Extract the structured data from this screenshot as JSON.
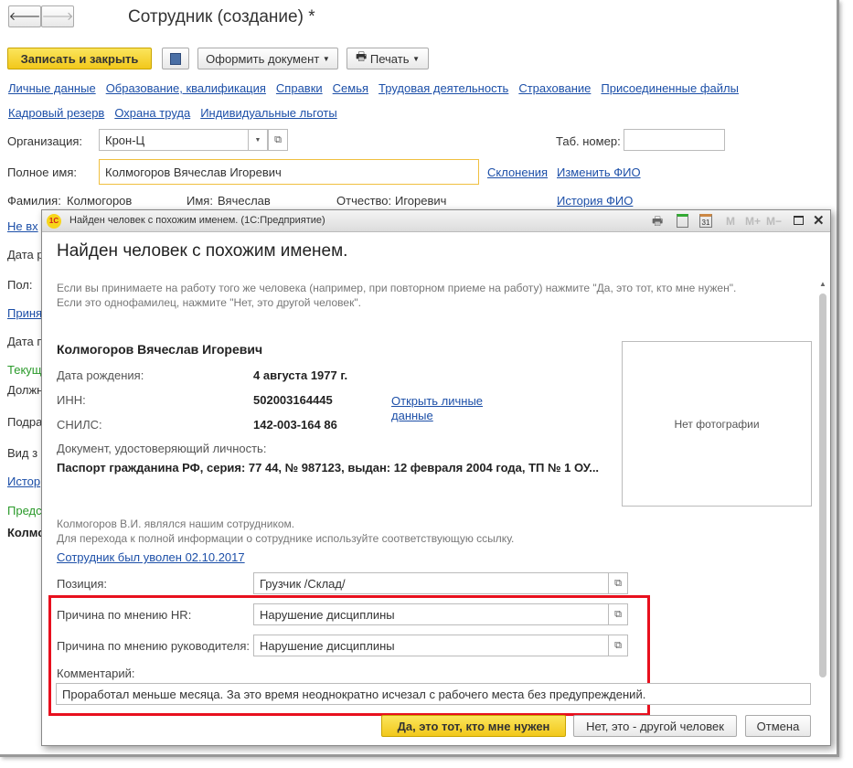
{
  "window": {
    "title": "Сотрудник (создание) *"
  },
  "toolbar": {
    "save_close": "Записать и закрыть",
    "make_doc": "Оформить документ",
    "print": "Печать"
  },
  "tabs_row1": [
    "Личные данные",
    "Образование, квалификация",
    "Справки",
    "Семья",
    "Трудовая деятельность",
    "Страхование",
    "Присоединенные файлы"
  ],
  "tabs_row2": [
    "Кадровый резерв",
    "Охрана труда",
    "Индивидуальные льготы"
  ],
  "form": {
    "org_label": "Организация:",
    "org_value": "Крон-Ц",
    "tab_num_label": "Таб. номер:",
    "fullname_label": "Полное имя:",
    "fullname_value": "Колмогоров Вячеслав Игоревич",
    "declension_link": "Склонения",
    "change_fio_link": "Изменить ФИО",
    "history_fio_link": "История ФИО",
    "surname_label": "Фамилия:",
    "surname_value": "Колмогоров",
    "name_label": "Имя:",
    "name_value": "Вячеслав",
    "patronymic_label": "Отчество:",
    "patronymic_value": "Игоревич",
    "left_fragments": [
      "Не вх",
      "Дата р",
      "Пол:",
      "Приня",
      "Дата п",
      "Текущ",
      "Должн",
      "Подра",
      "Вид з",
      "Истор",
      "Предс",
      "Колмо"
    ]
  },
  "dialog": {
    "title": "Найден человек с похожим именем.  (1С:Предприятие)",
    "title_icons": [
      "M",
      "M+",
      "M−"
    ],
    "heading": "Найден человек с похожим именем.",
    "hint1": "Если вы принимаете на работу того же человека (например, при повторном приеме на работу) нажмите \"Да, это тот, кто мне нужен\".",
    "hint2": "Если это однофамилец, нажмите \"Нет, это другой человек\".",
    "person_name": "Колмогоров Вячеслав Игоревич",
    "birth_label": "Дата рождения:",
    "birth_value": "4 августа 1977 г.",
    "inn_label": "ИНН:",
    "inn_value": "502003164445",
    "snils_label": "СНИЛС:",
    "snils_value": "142-003-164 86",
    "open_personal_link1": "Открыть личные",
    "open_personal_link2": "данные",
    "doc_label": "Документ, удостоверяющий личность:",
    "doc_value": "Паспорт гражданина РФ, серия: 77 44, № 987123, выдан: 12 февраля 2004 года, ТП № 1 ОУ...",
    "no_photo": "Нет фотографии",
    "was_employee": "Колмогоров В.И. являлся нашим сотрудником.",
    "goto_hint": "Для перехода к полной информации о сотруднике используйте соответствующую ссылку.",
    "fired_link": "Сотрудник был уволен 02.10.2017",
    "position_label": "Позиция:",
    "position_value": "Грузчик /Склад/",
    "hr_reason_label": "Причина по мнению HR:",
    "hr_reason_value": "Нарушение дисциплины",
    "mgr_reason_label": "Причина по мнению руководителя:",
    "mgr_reason_value": "Нарушение дисциплины",
    "comment_label": "Комментарий:",
    "comment_value": "Проработал меньше месяца. За это время неоднократно исчезал с рабочего места без предупреждений.",
    "btn_yes": "Да, это тот, кто мне нужен",
    "btn_no": "Нет, это - другой человек",
    "btn_cancel": "Отмена"
  },
  "colors": {
    "highlight": "#e8101e",
    "accent_yellow": "#f2c81b",
    "link": "#1c4fa8",
    "green": "#2a9a2a"
  }
}
